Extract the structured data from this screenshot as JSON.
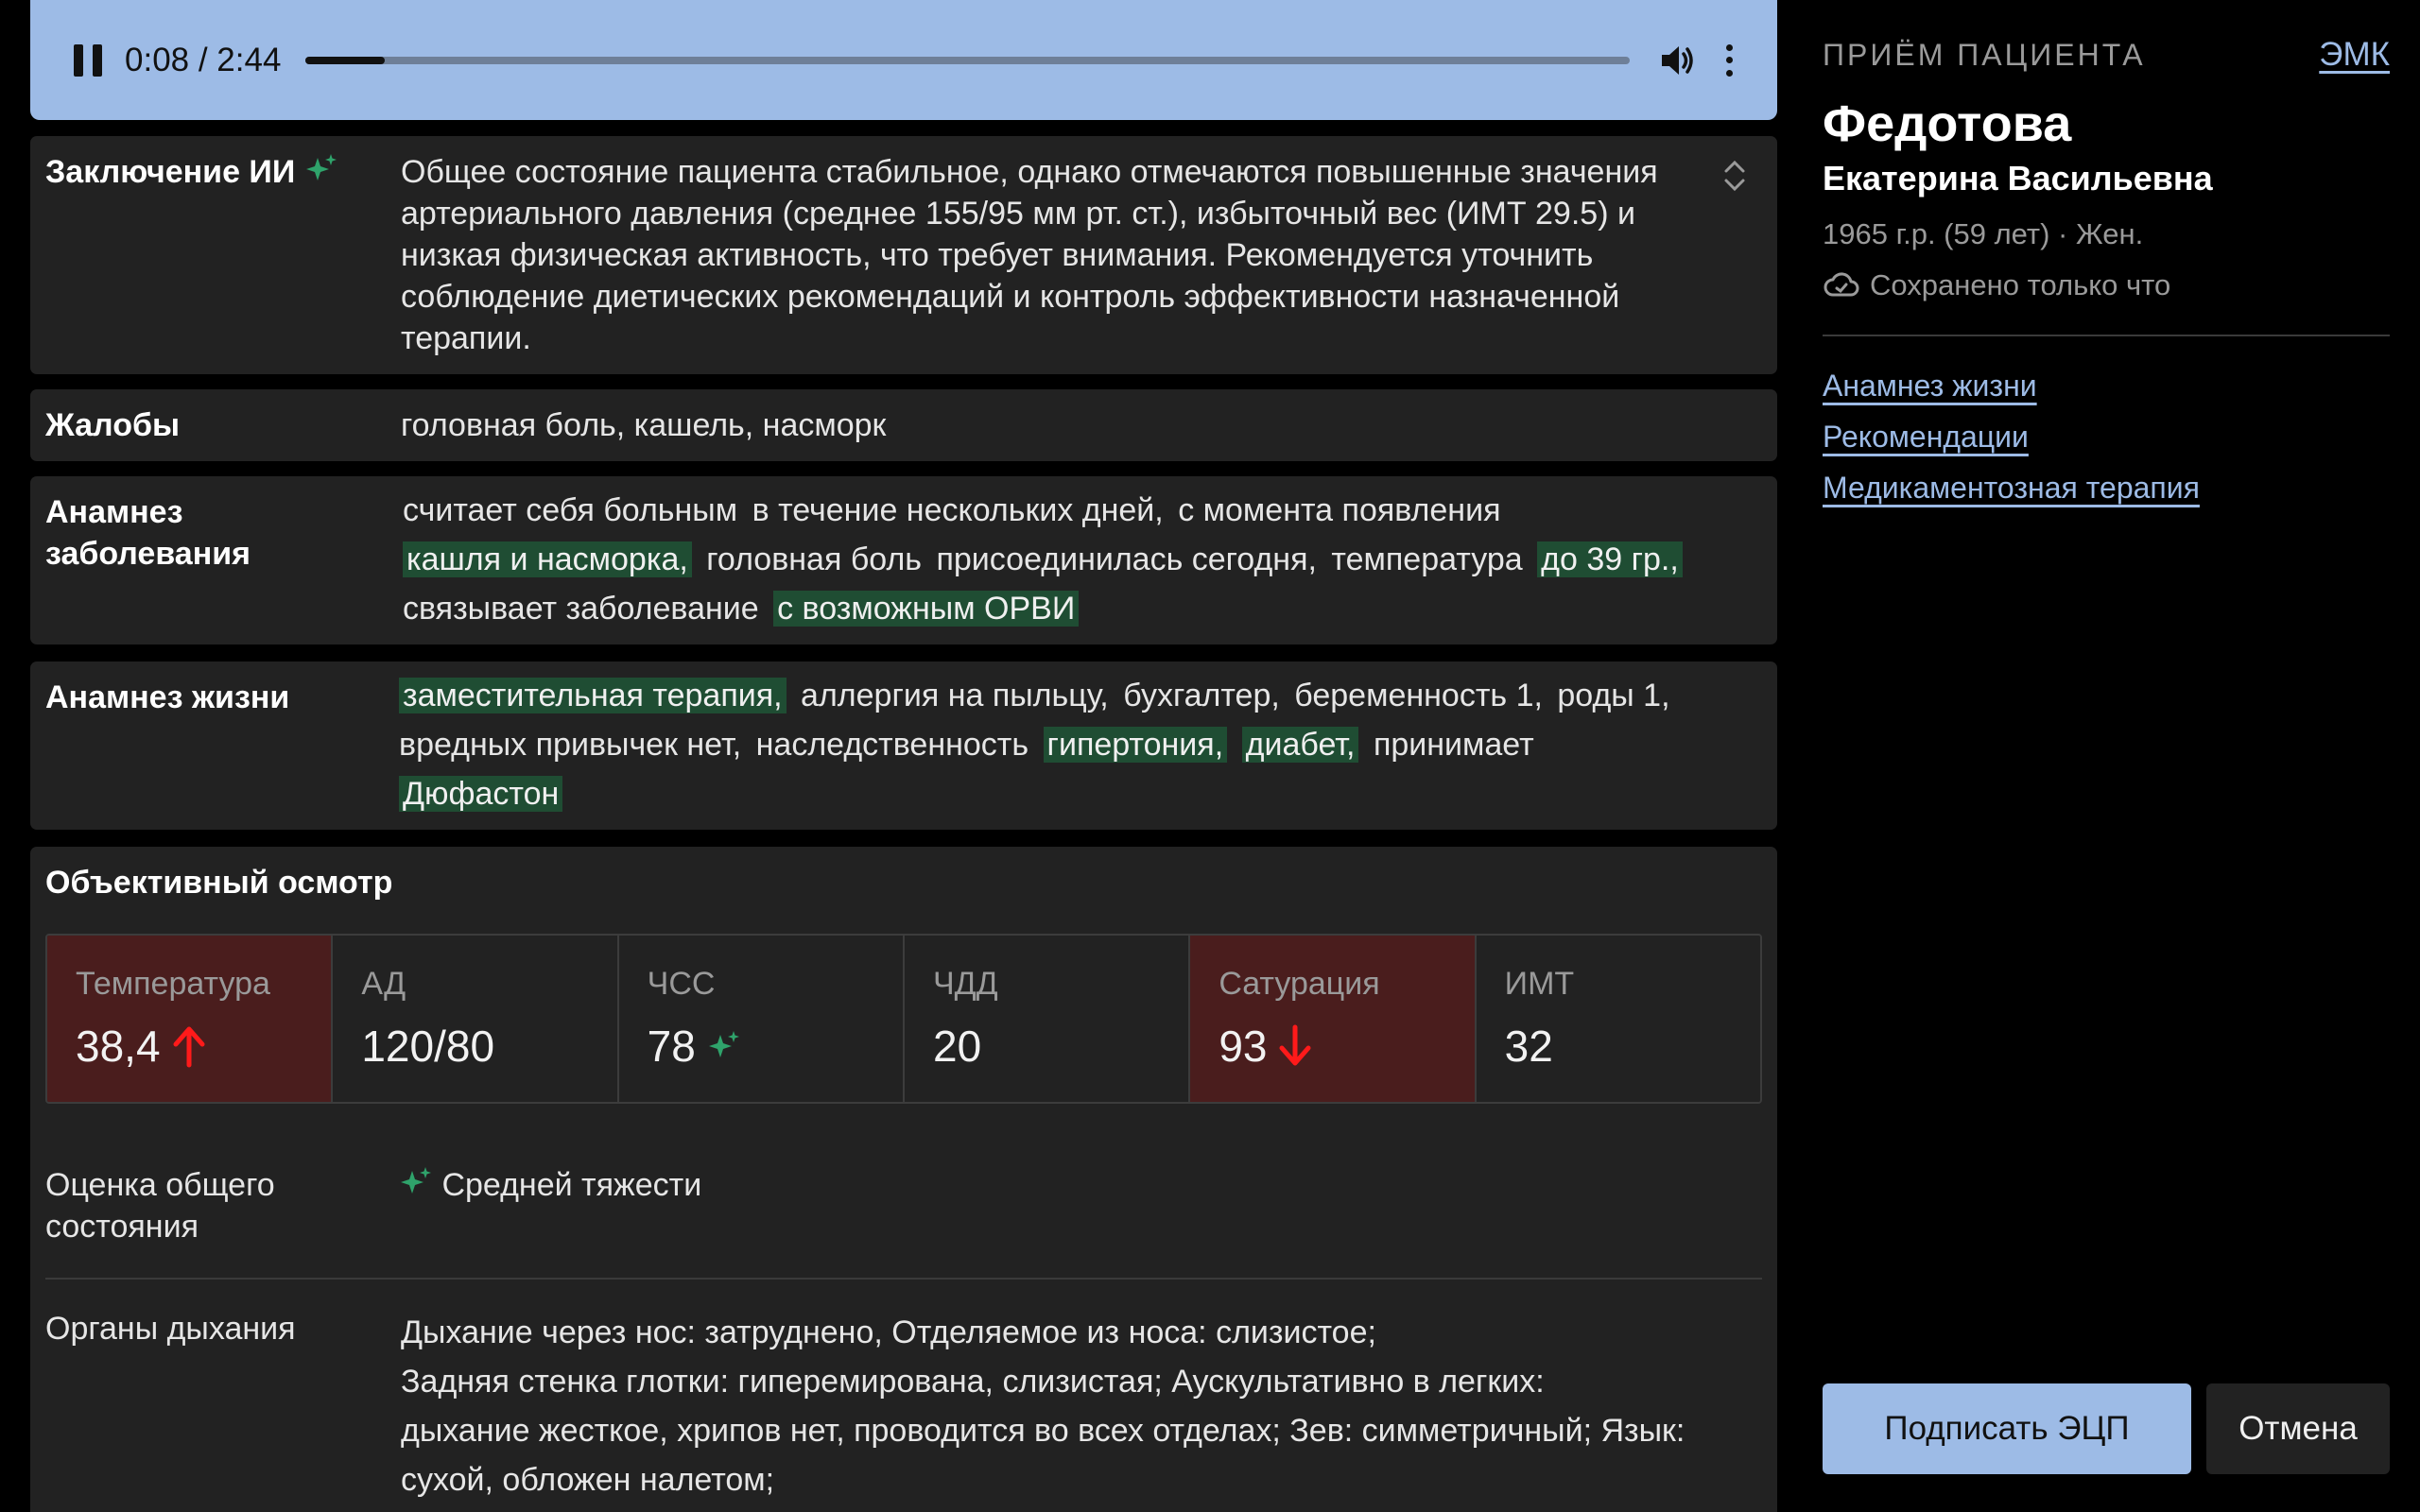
{
  "player": {
    "time": "0:08 / 2:44",
    "progress": 0.06,
    "icons": [
      "pause-icon",
      "volume-icon",
      "more-vertical-icon"
    ]
  },
  "conclusion": {
    "label": "Заключение ИИ",
    "text": "Общее состояние пациента стабильное, однако отмечаются повышенные значения артериального давления (среднее 155/95 мм рт. ст.), избыточный вес (ИМТ 29.5) и низкая физическая активность, что требует внимания. Рекомендуется уточнить соблюдение диетических рекомендаций и контроль эффективности назначенной терапии."
  },
  "complaints": {
    "label": "Жалобы",
    "text": "головная боль, кашель, насморк"
  },
  "disease_history": {
    "label_line1": "Анамнез",
    "label_line2": "заболевания",
    "t1": "считает себя больным",
    "t2": "в течение нескольких дней,",
    "t3": "с момента появления",
    "h1": "кашля и насморка,",
    "t4": "головная боль",
    "t5": "присоединилась сегодня,",
    "t6": "температура",
    "h2": "до 39 гр.,",
    "t7": "связывает заболевание",
    "h3": "с возможным ОРВИ"
  },
  "life_history": {
    "label": "Анамнез жизни",
    "h1": "заместительная терапия,",
    "t1": "аллергия на пыльцу,",
    "t2": "бухгалтер,",
    "t3": "беременность 1,",
    "t4": "роды 1,",
    "t5": "вредных привычек нет,",
    "t6": "наследственность",
    "h2": "гипертония,",
    "h3": "диабет,",
    "t7": "принимает",
    "h4": "Дюфастон"
  },
  "exam": {
    "title": "Объективный осмотр",
    "vitals": [
      {
        "label": "Температура",
        "value": "38,4"
      },
      {
        "label": "АД",
        "value": "120/80"
      },
      {
        "label": "ЧСС",
        "value": "78"
      },
      {
        "label": "ЧДД",
        "value": "20"
      },
      {
        "label": "Сатурация",
        "value": "93"
      },
      {
        "label": "ИМТ",
        "value": "32"
      }
    ],
    "alert_color": "#4a1d1d",
    "arrow_color": "#ff1a1a",
    "state_label_line1": "Оценка общего",
    "state_label_line2": "состояния",
    "state_value": "Средней тяжести",
    "resp_label": "Органы дыхания",
    "resp_line1": "Дыхание через нос: затруднено, Отделяемое из носа: слизистое;",
    "resp_line2": "Задняя стенка глотки: гиперемирована, слизистая; Аускультативно в легких:",
    "resp_line3": "дыхание жесткое, хрипов нет, проводится во всех отделах; Зев: симметричный; Язык:",
    "resp_line4": "сухой, обложен налетом;"
  },
  "patient": {
    "caps_title": "ПРИЁМ ПАЦИЕНТА",
    "emk_link": "ЭМК",
    "surname": "Федотова",
    "names": "Екатерина Васильевна",
    "meta": "1965 г.р. (59 лет)  ·  Жен.",
    "saved": "Сохранено только что",
    "links": [
      "Анамнез жизни",
      "Рекомендации",
      "Медикаментозная терапия"
    ],
    "sign_button": "Подписать ЭЦП",
    "cancel_button": "Отмена"
  },
  "colors": {
    "accent": "#9dbbe6",
    "highlight_bg": "#1f4d33",
    "ai_sparkle": "#2fa36b",
    "card_bg": "#222222"
  }
}
